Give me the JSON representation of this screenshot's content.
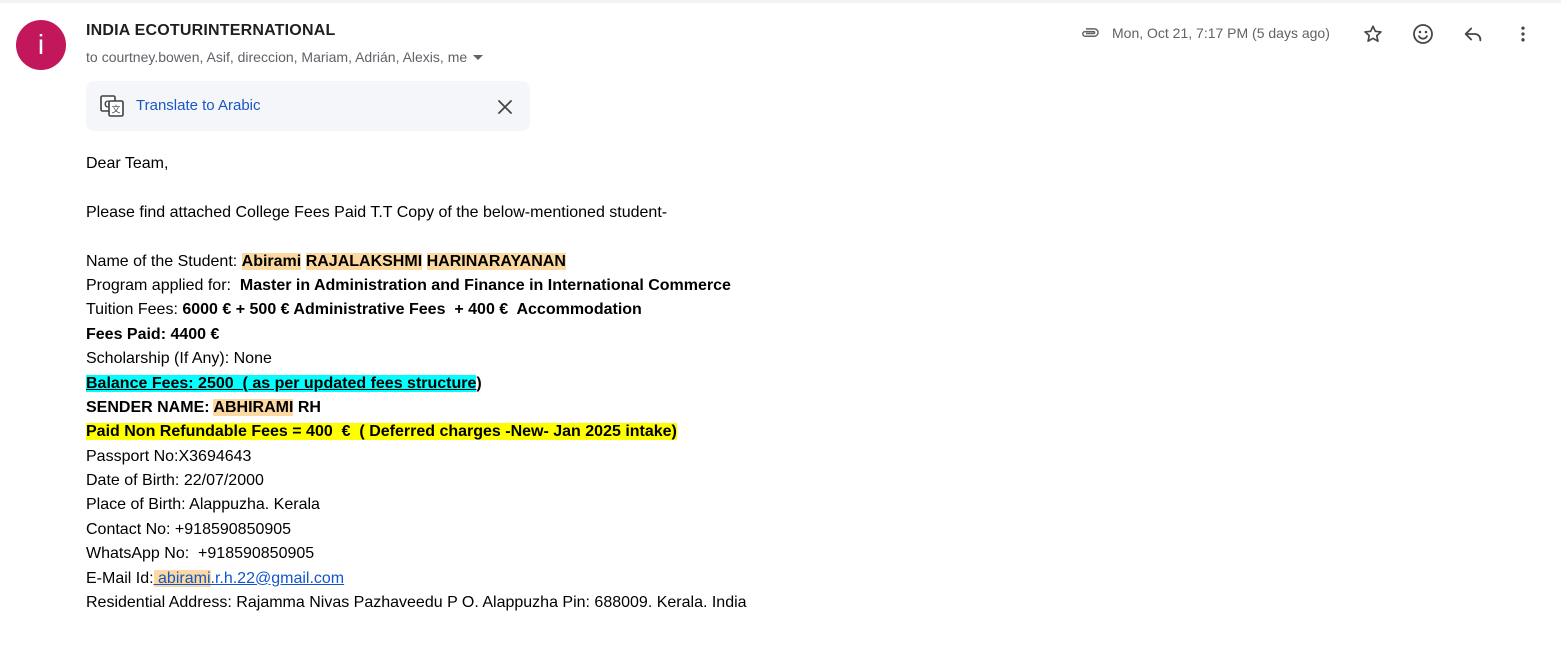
{
  "header": {
    "avatar_letter": "i",
    "avatar_color": "#c2185b",
    "sender": "INDIA ECOTURINTERNATIONAL",
    "recipients_prefix": "to",
    "recipients": "courtney.bowen, Asif, direccion, Mariam, Adrián, Alexis, me",
    "date": "Mon, Oct 21, 7:17 PM (5 days ago)",
    "icons": [
      "attachment-icon",
      "star-icon",
      "emoji-icon",
      "reply-icon",
      "more-vert-icon"
    ]
  },
  "translate": {
    "label": "Translate to Arabic",
    "icon": "google-translate-icon",
    "close_icon": "close-icon"
  },
  "email": {
    "greeting": "Dear Team,",
    "intro": "Please find attached College Fees Paid T.T Copy of the below-mentioned student-",
    "student_label": "Name of the Student: ",
    "student_first": "Abirami",
    "student_middle": "RAJALAKSHMI",
    "student_last": "HARINARAYANAN",
    "program_label": "Program applied for:  ",
    "program_value": "Master in Administration and Finance in International Commerce",
    "tuition_label": "Tuition Fees: ",
    "tuition_value": "6000 € + 500 € Administrative Fees  + 400 €  Accommodation",
    "fees_paid": "Fees Paid: 4400 €",
    "scholarship": "Scholarship (If Any): None",
    "balance_main": "Balance Fees: 2500  ",
    "balance_paren": "( as per updated fees structure",
    "balance_close": ")",
    "sender_label": "SENDER NAME: ",
    "sender_first": "ABHIRAMI",
    "sender_last": " RH",
    "non_refundable": "Paid Non Refundable Fees = 400  €  ( Deferred charges -New- Jan 2025 intake)",
    "passport": "Passport No:X3694643",
    "dob": "Date of Birth: 22/07/2000",
    "pob": "Place of Birth: Alappuzha. Kerala",
    "contact": "Contact No: +918590850905",
    "whatsapp": "WhatsApp No:  +918590850905",
    "email_label": "E-Mail Id:",
    "email_space": " ",
    "email_hl": "abirami",
    "email_rest": ".r.h.22@gmail.com",
    "address": "Residential Address: Rajamma Nivas Pazhaveedu P O. Alappuzha Pin: 688009. Kerala. India"
  },
  "colors": {
    "highlight_orange": "#fcd9a0",
    "highlight_cyan": "#00ffff",
    "highlight_yellow": "#ffff00",
    "link_blue": "#1a56c4"
  }
}
